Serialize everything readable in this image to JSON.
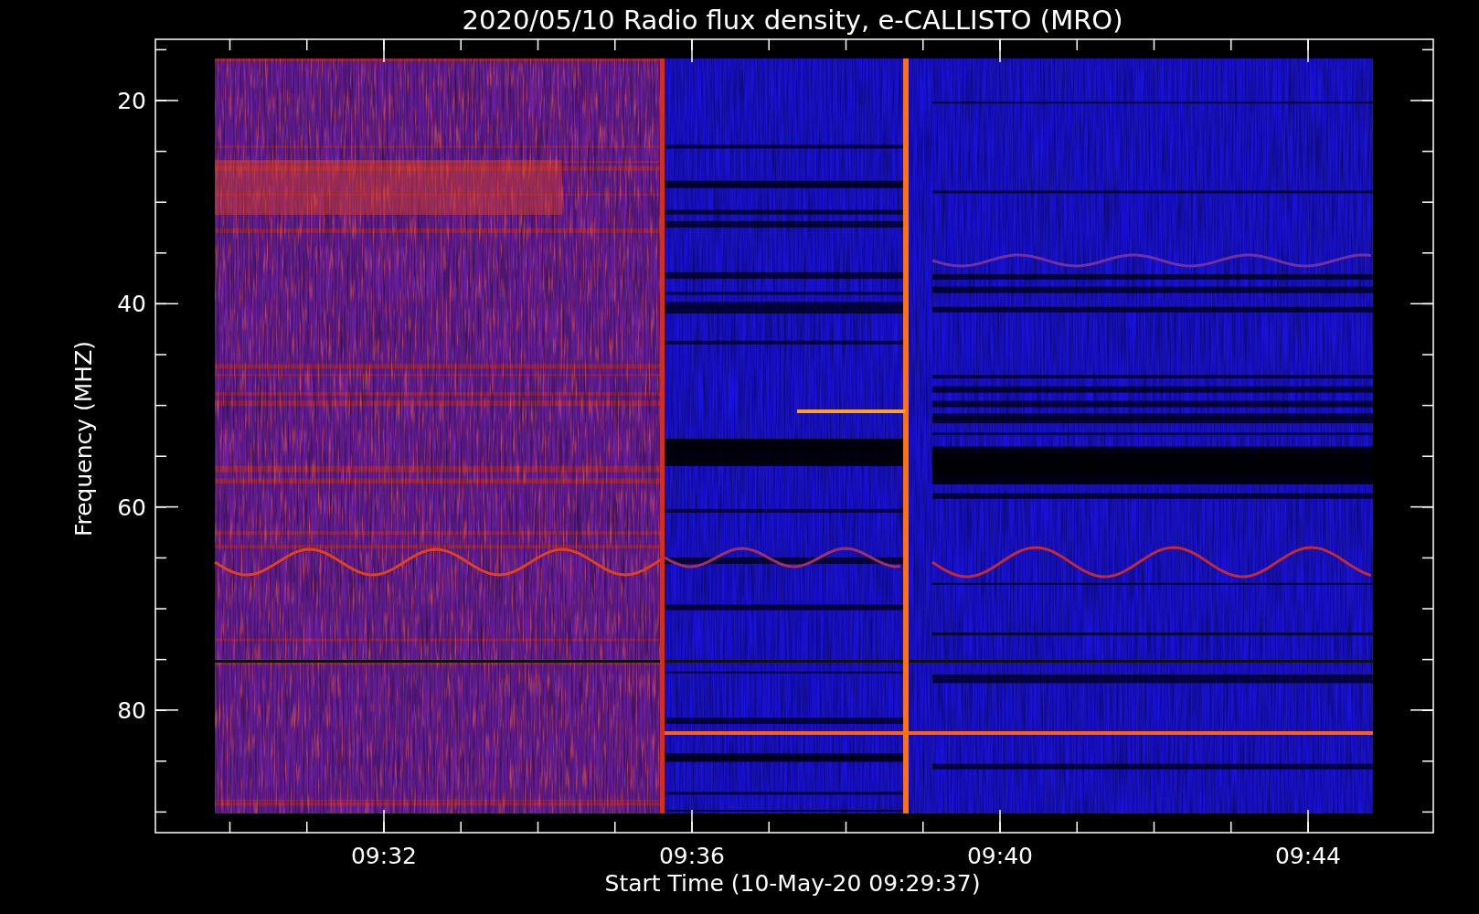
{
  "title": "2020/05/10  Radio flux density, e-CALLISTO (MRO)",
  "y_axis": {
    "label": "Frequency (MHZ)",
    "ticks": [
      "20",
      "40",
      "60",
      "80"
    ]
  },
  "x_axis": {
    "label": "Start Time (10-May-20 09:29:37)",
    "ticks": [
      "09:32",
      "09:36",
      "09:40",
      "09:44"
    ]
  }
}
